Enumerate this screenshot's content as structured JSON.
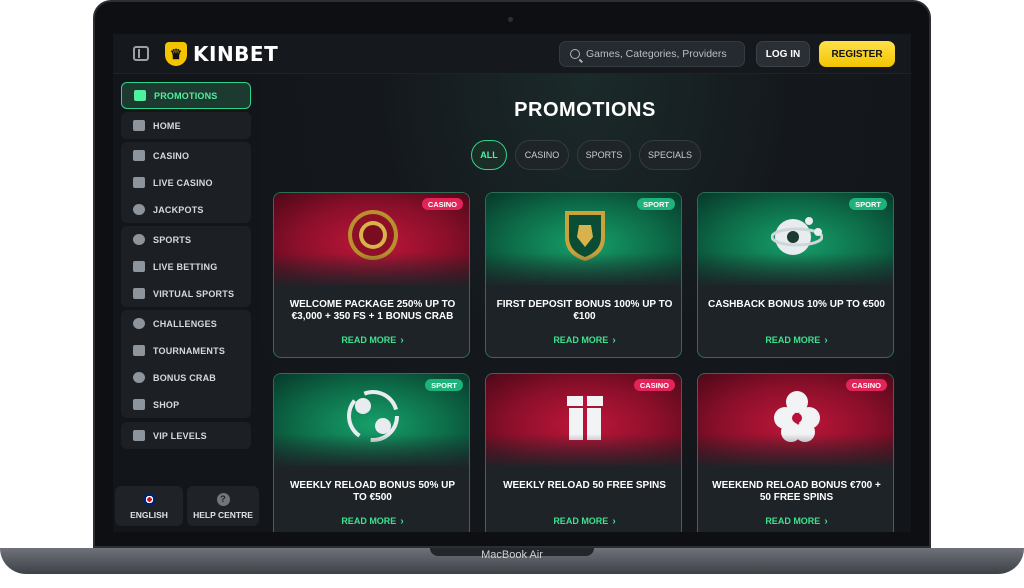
{
  "device": {
    "label": "MacBook Air"
  },
  "header": {
    "brand": "KINBET",
    "search_placeholder": "Games, Categories, Providers",
    "login_label": "LOG IN",
    "register_label": "REGISTER"
  },
  "sidebar": {
    "groups": [
      [
        {
          "label": "PROMOTIONS",
          "icon": "gift-icon",
          "active": true
        }
      ],
      [
        {
          "label": "HOME",
          "icon": "home-icon"
        }
      ],
      [
        {
          "label": "CASINO",
          "icon": "slot-machine-icon"
        },
        {
          "label": "LIVE CASINO",
          "icon": "card-icon"
        },
        {
          "label": "JACKPOTS",
          "icon": "clover-icon"
        }
      ],
      [
        {
          "label": "SPORTS",
          "icon": "soccer-ball-icon"
        },
        {
          "label": "LIVE BETTING",
          "icon": "live-icon"
        },
        {
          "label": "VIRTUAL SPORTS",
          "icon": "virtual-icon"
        }
      ],
      [
        {
          "label": "CHALLENGES",
          "icon": "medal-icon"
        },
        {
          "label": "TOURNAMENTS",
          "icon": "trophy-icon"
        },
        {
          "label": "BONUS CRAB",
          "icon": "crab-icon"
        },
        {
          "label": "SHOP",
          "icon": "basket-icon"
        }
      ],
      [
        {
          "label": "VIP LEVELS",
          "icon": "diamond-icon"
        }
      ]
    ],
    "footer": {
      "language": "ENGLISH",
      "help": "HELP CENTRE"
    }
  },
  "main": {
    "title": "PROMOTIONS",
    "filters": [
      "ALL",
      "CASINO",
      "SPORTS",
      "SPECIALS"
    ],
    "active_filter": "ALL",
    "cards": [
      {
        "badge": "CASINO",
        "theme": "red",
        "title": "WELCOME PACKAGE 250% UP TO €3,000 + 350 FS + 1 BONUS CRAB",
        "cta": "READ MORE"
      },
      {
        "badge": "SPORT",
        "theme": "green",
        "title": "FIRST DEPOSIT BONUS 100% UP TO €100",
        "cta": "READ MORE"
      },
      {
        "badge": "SPORT",
        "theme": "green",
        "title": "CASHBACK BONUS 10% UP TO €500",
        "cta": "READ MORE"
      },
      {
        "badge": "SPORT",
        "theme": "green",
        "title": "WEEKLY RELOAD BONUS 50% UP TO €500",
        "cta": "READ MORE"
      },
      {
        "badge": "CASINO",
        "theme": "red",
        "title": "WEEKLY RELOAD 50 FREE SPINS",
        "cta": "READ MORE"
      },
      {
        "badge": "CASINO",
        "theme": "red",
        "title": "WEEKEND RELOAD BONUS €700 + 50 FREE SPINS",
        "cta": "READ MORE"
      }
    ]
  },
  "colors": {
    "accent": "#2fd48a",
    "register": "#f2c500",
    "casino_badge": "#e3245a",
    "sport_badge": "#1db37a"
  }
}
